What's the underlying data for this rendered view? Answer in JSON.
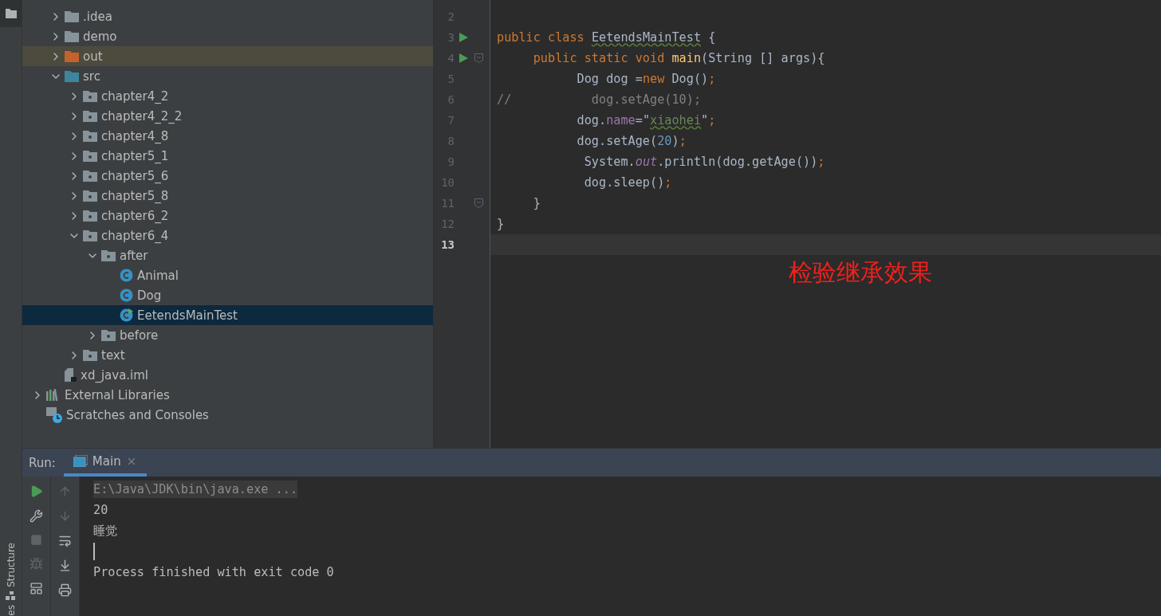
{
  "tree": {
    "items": [
      {
        "label": ".idea",
        "kind": "folder",
        "expanded": false,
        "selected": false
      },
      {
        "label": "demo",
        "kind": "folder",
        "expanded": false,
        "selected": false
      },
      {
        "label": "out",
        "kind": "excluded-folder",
        "expanded": false,
        "selected": false
      },
      {
        "label": "src",
        "kind": "source-folder",
        "expanded": true,
        "selected": false,
        "children": [
          {
            "label": "chapter4_2",
            "kind": "package",
            "expanded": false,
            "selected": false
          },
          {
            "label": "chapter4_2_2",
            "kind": "package",
            "expanded": false,
            "selected": false
          },
          {
            "label": "chapter4_8",
            "kind": "package",
            "expanded": false,
            "selected": false
          },
          {
            "label": "chapter5_1",
            "kind": "package",
            "expanded": false,
            "selected": false
          },
          {
            "label": "chapter5_6",
            "kind": "package",
            "expanded": false,
            "selected": false
          },
          {
            "label": "chapter5_8",
            "kind": "package",
            "expanded": false,
            "selected": false
          },
          {
            "label": "chapter6_2",
            "kind": "package",
            "expanded": false,
            "selected": false
          },
          {
            "label": "chapter6_4",
            "kind": "package",
            "expanded": true,
            "selected": false,
            "children": [
              {
                "label": "after",
                "kind": "package",
                "expanded": true,
                "selected": false,
                "children": [
                  {
                    "label": "Animal",
                    "kind": "class",
                    "selected": false
                  },
                  {
                    "label": "Dog",
                    "kind": "class",
                    "selected": false
                  },
                  {
                    "label": "EetendsMainTest",
                    "kind": "main-class",
                    "selected": true
                  }
                ]
              },
              {
                "label": "before",
                "kind": "package",
                "expanded": false,
                "selected": false
              }
            ]
          },
          {
            "label": "text",
            "kind": "package",
            "expanded": false,
            "selected": false
          }
        ]
      },
      {
        "label": "xd_java.iml",
        "kind": "file",
        "selected": false
      }
    ],
    "root_items": [
      {
        "label": "External Libraries",
        "kind": "libraries",
        "expanded": false,
        "selected": false
      },
      {
        "label": "Scratches and Consoles",
        "kind": "scratches",
        "selected": false
      }
    ]
  },
  "editor": {
    "lines": [
      {
        "number": "2",
        "run": false,
        "fold": false,
        "current": false
      },
      {
        "number": "3",
        "run": true,
        "fold": false,
        "current": false,
        "tokens": [
          {
            "text": "public class ",
            "kind": "keyword"
          },
          {
            "text": "EetendsMainTest",
            "kind": "typo"
          },
          {
            "text": " {",
            "kind": "plain"
          }
        ]
      },
      {
        "number": "4",
        "run": true,
        "fold": true,
        "current": false,
        "tokens": [
          {
            "text": "     public static void ",
            "kind": "keyword"
          },
          {
            "text": "main",
            "kind": "function"
          },
          {
            "text": "(String [] args){",
            "kind": "plain"
          }
        ]
      },
      {
        "number": "5",
        "run": false,
        "fold": false,
        "current": false,
        "tokens": [
          {
            "text": "           Dog dog =",
            "kind": "plain"
          },
          {
            "text": "new ",
            "kind": "keyword"
          },
          {
            "text": "Dog()",
            "kind": "plain"
          },
          {
            "text": ";",
            "kind": "keyword"
          }
        ]
      },
      {
        "number": "6",
        "run": false,
        "fold": false,
        "current": false,
        "tokens": [
          {
            "text": "//           dog.setAge(10);",
            "kind": "comment"
          }
        ]
      },
      {
        "number": "7",
        "run": false,
        "fold": false,
        "current": false,
        "tokens": [
          {
            "text": "           dog.",
            "kind": "plain"
          },
          {
            "text": "name",
            "kind": "field"
          },
          {
            "text": "=\"",
            "kind": "plain"
          },
          {
            "text": "xiaohei",
            "kind": "string"
          },
          {
            "text": "\"",
            "kind": "plain"
          },
          {
            "text": ";",
            "kind": "keyword"
          }
        ]
      },
      {
        "number": "8",
        "run": false,
        "fold": false,
        "current": false,
        "tokens": [
          {
            "text": "           dog.setAge(",
            "kind": "plain"
          },
          {
            "text": "20",
            "kind": "number"
          },
          {
            "text": ")",
            "kind": "plain"
          },
          {
            "text": ";",
            "kind": "keyword"
          }
        ]
      },
      {
        "number": "9",
        "run": false,
        "fold": false,
        "current": false,
        "tokens": [
          {
            "text": "            System.",
            "kind": "plain"
          },
          {
            "text": "out",
            "kind": "static"
          },
          {
            "text": ".println(dog.getAge())",
            "kind": "plain"
          },
          {
            "text": ";",
            "kind": "keyword"
          }
        ]
      },
      {
        "number": "10",
        "run": false,
        "fold": false,
        "current": false,
        "tokens": [
          {
            "text": "            dog.sleep()",
            "kind": "plain"
          },
          {
            "text": ";",
            "kind": "keyword"
          }
        ]
      },
      {
        "number": "11",
        "run": false,
        "fold": true,
        "current": false,
        "tokens": [
          {
            "text": "     }",
            "kind": "plain"
          }
        ]
      },
      {
        "number": "12",
        "run": false,
        "fold": false,
        "current": false,
        "tokens": [
          {
            "text": "}",
            "kind": "plain"
          }
        ]
      },
      {
        "number": "13",
        "run": false,
        "fold": false,
        "current": true
      }
    ]
  },
  "annotation": "检验继承效果",
  "side_strip": {
    "label": "Structure",
    "partial_label": "es"
  },
  "run_panel": {
    "label": "Run:",
    "tabs": [
      {
        "label": "Main",
        "selected": true
      }
    ],
    "console": [
      {
        "kind": "command",
        "text": "E:\\Java\\JDK\\bin\\java.exe ..."
      },
      {
        "kind": "output",
        "text": "20"
      },
      {
        "kind": "output",
        "text": "睡觉"
      },
      {
        "kind": "cursor"
      },
      {
        "kind": "output",
        "text": "Process finished with exit code 0"
      }
    ]
  }
}
